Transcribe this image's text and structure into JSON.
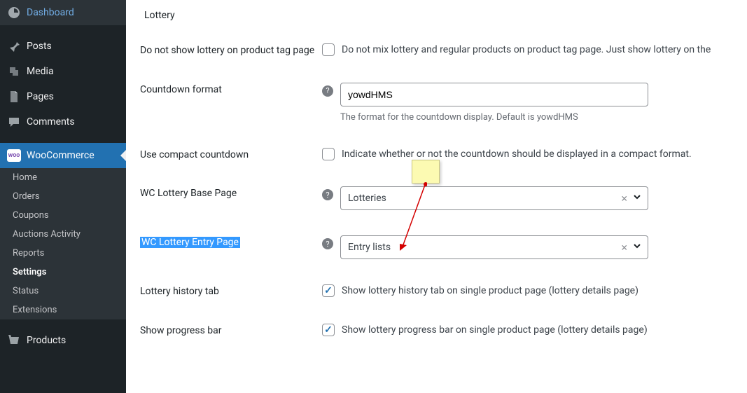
{
  "sidebar": {
    "top": [
      {
        "key": "dashboard",
        "label": "Dashboard"
      },
      {
        "key": "posts",
        "label": "Posts"
      },
      {
        "key": "media",
        "label": "Media"
      },
      {
        "key": "pages",
        "label": "Pages"
      },
      {
        "key": "comments",
        "label": "Comments"
      },
      {
        "key": "woocommerce",
        "label": "WooCommerce"
      }
    ],
    "sub": [
      {
        "key": "home",
        "label": "Home"
      },
      {
        "key": "orders",
        "label": "Orders"
      },
      {
        "key": "coupons",
        "label": "Coupons"
      },
      {
        "key": "auctions",
        "label": "Auctions Activity"
      },
      {
        "key": "reports",
        "label": "Reports"
      },
      {
        "key": "settings",
        "label": "Settings"
      },
      {
        "key": "status",
        "label": "Status"
      },
      {
        "key": "extensions",
        "label": "Extensions"
      }
    ],
    "bottom": [
      {
        "key": "products",
        "label": "Products"
      }
    ]
  },
  "tab": {
    "label": "Lottery"
  },
  "settings": {
    "tag_mix": {
      "label": "Do not show lottery on product tag page",
      "cb_label": "Do not mix lottery and regular products on product tag page. Just show lottery on the"
    },
    "countdown": {
      "label": "Countdown format",
      "value": "yowdHMS",
      "help": "The format for the countdown display. Default is yowdHMS"
    },
    "compact": {
      "label": "Use compact countdown",
      "cb_label": "Indicate whether or not the countdown should be displayed in a compact format."
    },
    "base_page": {
      "label": "WC Lottery Base Page",
      "value": "Lotteries"
    },
    "entry_page": {
      "label": "WC Lottery Entry Page",
      "value": "Entry lists"
    },
    "history": {
      "label": "Lottery history tab",
      "cb_label": "Show lottery history tab on single product page (lottery details page)"
    },
    "progress": {
      "label": "Show progress bar",
      "cb_label": "Show lottery progress bar on single product page (lottery details page)"
    }
  },
  "icons": {
    "help": "?",
    "clear": "×",
    "woo": "woo"
  }
}
